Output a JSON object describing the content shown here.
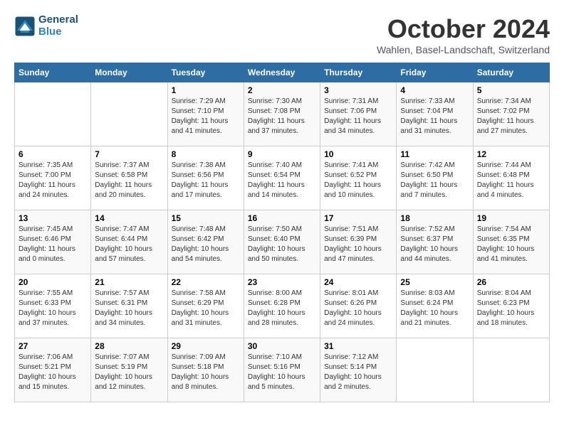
{
  "app": {
    "logo_line1": "General",
    "logo_line2": "Blue"
  },
  "header": {
    "title": "October 2024",
    "location": "Wahlen, Basel-Landschaft, Switzerland"
  },
  "columns": [
    "Sunday",
    "Monday",
    "Tuesday",
    "Wednesday",
    "Thursday",
    "Friday",
    "Saturday"
  ],
  "weeks": [
    [
      {
        "day": "",
        "info": ""
      },
      {
        "day": "",
        "info": ""
      },
      {
        "day": "1",
        "info": "Sunrise: 7:29 AM\nSunset: 7:10 PM\nDaylight: 11 hours and 41 minutes."
      },
      {
        "day": "2",
        "info": "Sunrise: 7:30 AM\nSunset: 7:08 PM\nDaylight: 11 hours and 37 minutes."
      },
      {
        "day": "3",
        "info": "Sunrise: 7:31 AM\nSunset: 7:06 PM\nDaylight: 11 hours and 34 minutes."
      },
      {
        "day": "4",
        "info": "Sunrise: 7:33 AM\nSunset: 7:04 PM\nDaylight: 11 hours and 31 minutes."
      },
      {
        "day": "5",
        "info": "Sunrise: 7:34 AM\nSunset: 7:02 PM\nDaylight: 11 hours and 27 minutes."
      }
    ],
    [
      {
        "day": "6",
        "info": "Sunrise: 7:35 AM\nSunset: 7:00 PM\nDaylight: 11 hours and 24 minutes."
      },
      {
        "day": "7",
        "info": "Sunrise: 7:37 AM\nSunset: 6:58 PM\nDaylight: 11 hours and 20 minutes."
      },
      {
        "day": "8",
        "info": "Sunrise: 7:38 AM\nSunset: 6:56 PM\nDaylight: 11 hours and 17 minutes."
      },
      {
        "day": "9",
        "info": "Sunrise: 7:40 AM\nSunset: 6:54 PM\nDaylight: 11 hours and 14 minutes."
      },
      {
        "day": "10",
        "info": "Sunrise: 7:41 AM\nSunset: 6:52 PM\nDaylight: 11 hours and 10 minutes."
      },
      {
        "day": "11",
        "info": "Sunrise: 7:42 AM\nSunset: 6:50 PM\nDaylight: 11 hours and 7 minutes."
      },
      {
        "day": "12",
        "info": "Sunrise: 7:44 AM\nSunset: 6:48 PM\nDaylight: 11 hours and 4 minutes."
      }
    ],
    [
      {
        "day": "13",
        "info": "Sunrise: 7:45 AM\nSunset: 6:46 PM\nDaylight: 11 hours and 0 minutes."
      },
      {
        "day": "14",
        "info": "Sunrise: 7:47 AM\nSunset: 6:44 PM\nDaylight: 10 hours and 57 minutes."
      },
      {
        "day": "15",
        "info": "Sunrise: 7:48 AM\nSunset: 6:42 PM\nDaylight: 10 hours and 54 minutes."
      },
      {
        "day": "16",
        "info": "Sunrise: 7:50 AM\nSunset: 6:40 PM\nDaylight: 10 hours and 50 minutes."
      },
      {
        "day": "17",
        "info": "Sunrise: 7:51 AM\nSunset: 6:39 PM\nDaylight: 10 hours and 47 minutes."
      },
      {
        "day": "18",
        "info": "Sunrise: 7:52 AM\nSunset: 6:37 PM\nDaylight: 10 hours and 44 minutes."
      },
      {
        "day": "19",
        "info": "Sunrise: 7:54 AM\nSunset: 6:35 PM\nDaylight: 10 hours and 41 minutes."
      }
    ],
    [
      {
        "day": "20",
        "info": "Sunrise: 7:55 AM\nSunset: 6:33 PM\nDaylight: 10 hours and 37 minutes."
      },
      {
        "day": "21",
        "info": "Sunrise: 7:57 AM\nSunset: 6:31 PM\nDaylight: 10 hours and 34 minutes."
      },
      {
        "day": "22",
        "info": "Sunrise: 7:58 AM\nSunset: 6:29 PM\nDaylight: 10 hours and 31 minutes."
      },
      {
        "day": "23",
        "info": "Sunrise: 8:00 AM\nSunset: 6:28 PM\nDaylight: 10 hours and 28 minutes."
      },
      {
        "day": "24",
        "info": "Sunrise: 8:01 AM\nSunset: 6:26 PM\nDaylight: 10 hours and 24 minutes."
      },
      {
        "day": "25",
        "info": "Sunrise: 8:03 AM\nSunset: 6:24 PM\nDaylight: 10 hours and 21 minutes."
      },
      {
        "day": "26",
        "info": "Sunrise: 8:04 AM\nSunset: 6:23 PM\nDaylight: 10 hours and 18 minutes."
      }
    ],
    [
      {
        "day": "27",
        "info": "Sunrise: 7:06 AM\nSunset: 5:21 PM\nDaylight: 10 hours and 15 minutes."
      },
      {
        "day": "28",
        "info": "Sunrise: 7:07 AM\nSunset: 5:19 PM\nDaylight: 10 hours and 12 minutes."
      },
      {
        "day": "29",
        "info": "Sunrise: 7:09 AM\nSunset: 5:18 PM\nDaylight: 10 hours and 8 minutes."
      },
      {
        "day": "30",
        "info": "Sunrise: 7:10 AM\nSunset: 5:16 PM\nDaylight: 10 hours and 5 minutes."
      },
      {
        "day": "31",
        "info": "Sunrise: 7:12 AM\nSunset: 5:14 PM\nDaylight: 10 hours and 2 minutes."
      },
      {
        "day": "",
        "info": ""
      },
      {
        "day": "",
        "info": ""
      }
    ]
  ]
}
